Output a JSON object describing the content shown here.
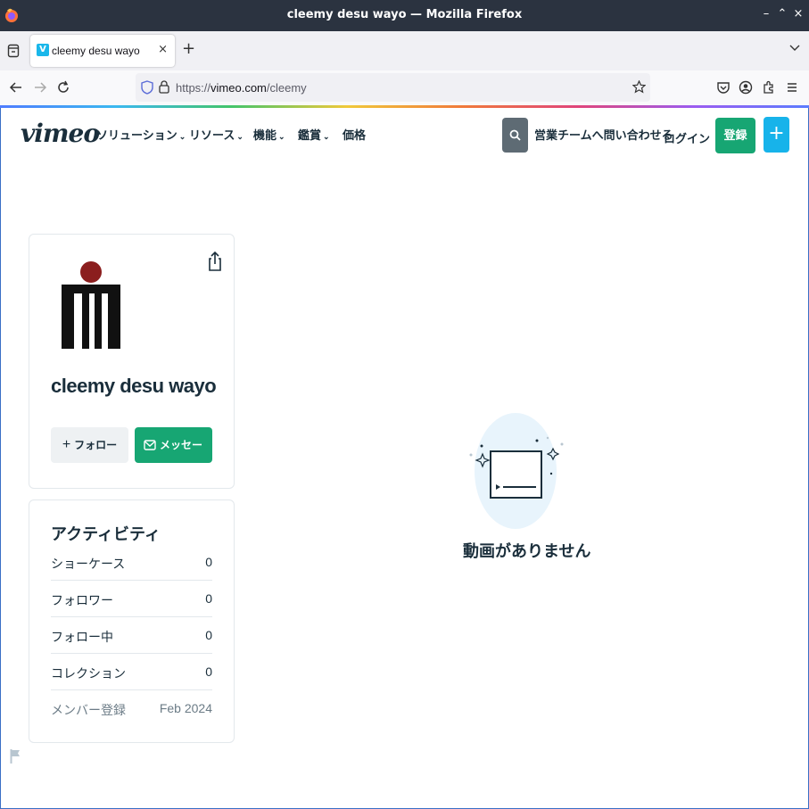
{
  "window": {
    "title": "cleemy desu wayo — Mozilla Firefox",
    "controls": [
      "–",
      "⌃",
      "×"
    ]
  },
  "browser": {
    "tab_title": "cleemy desu wayo",
    "tab_close": "×",
    "new_tab": "+",
    "url_scheme": "https://",
    "url_host": "vimeo.com",
    "url_path": "/cleemy"
  },
  "nav": {
    "logo": "vimeo",
    "menu": [
      {
        "label": "ソリューション",
        "chevron": "⌄"
      },
      {
        "label": "リソース",
        "chevron": "⌄"
      },
      {
        "label": "機能",
        "chevron": "⌄"
      },
      {
        "label": "鑑賞",
        "chevron": "⌄"
      },
      {
        "label": "価格",
        "chevron": ""
      }
    ],
    "contact_sales": "営業チームへ問い合わせる",
    "login": "ログイン",
    "signup": "登録",
    "plus": "+"
  },
  "profile": {
    "name": "cleemy desu wayo",
    "follow_icon": "+",
    "follow_label": "フォロー",
    "message_label": "メッセージ"
  },
  "activity": {
    "title": "アクティビティ",
    "rows": [
      {
        "label": "ショーケース",
        "value": "0"
      },
      {
        "label": "フォロワー",
        "value": "0"
      },
      {
        "label": "フォロー中",
        "value": "0"
      },
      {
        "label": "コレクション",
        "value": "0"
      },
      {
        "label": "メンバー登録",
        "value": "Feb 2024"
      }
    ]
  },
  "main": {
    "empty_text": "動画がありません"
  },
  "colors": {
    "brand_green": "#17a673",
    "brand_blue": "#17b3ea",
    "text_dark": "#1a2e3b"
  }
}
